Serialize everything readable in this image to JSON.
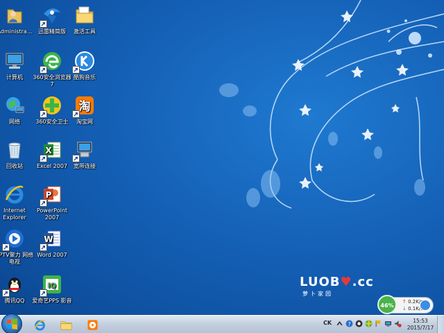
{
  "desktop_icons": [
    {
      "name": "administrator-icon",
      "label": "Administra...",
      "shortcut": false
    },
    {
      "name": "xunlei-icon",
      "label": "迅雷精简版",
      "shortcut": true
    },
    {
      "name": "activation-tools-icon",
      "label": "激活工具",
      "shortcut": false
    },
    {
      "name": "computer-icon",
      "label": "计算机",
      "shortcut": false
    },
    {
      "name": "360-browser-icon",
      "label": "360安全浏览器7",
      "shortcut": true
    },
    {
      "name": "kugou-music-icon",
      "label": "酷狗音乐",
      "shortcut": true
    },
    {
      "name": "network-icon",
      "label": "网络",
      "shortcut": false
    },
    {
      "name": "360-security-icon",
      "label": "360安全卫士",
      "shortcut": true
    },
    {
      "name": "taobao-icon",
      "label": "淘宝网",
      "shortcut": true
    },
    {
      "name": "recycle-bin-icon",
      "label": "回收站",
      "shortcut": false
    },
    {
      "name": "excel-icon",
      "label": "Excel 2007",
      "shortcut": true
    },
    {
      "name": "broadband-icon",
      "label": "宽带连接",
      "shortcut": true
    },
    {
      "name": "internet-explorer-icon",
      "label": "Internet Explorer",
      "shortcut": false
    },
    {
      "name": "powerpoint-icon",
      "label": "PowerPoint 2007",
      "shortcut": true
    },
    {
      "name": "pptv-icon",
      "label": "PPTV聚力 网络电视",
      "shortcut": true
    },
    {
      "name": "word-icon",
      "label": "Word 2007",
      "shortcut": true
    },
    {
      "name": "qq-icon",
      "label": "腾讯QQ",
      "shortcut": true
    },
    {
      "name": "iqiyi-icon",
      "label": "爱奇艺PPS 影音",
      "shortcut": true
    }
  ],
  "logo": {
    "main": "LUOB",
    "suffix": ".cc",
    "sub": "萝卜家园"
  },
  "net_widget": {
    "percent": "46%",
    "upload": "0.2K/s",
    "download": "0.1K/s",
    "up_arrow": "↑",
    "down_arrow": "↓"
  },
  "taskbar": {
    "pinned": [
      {
        "name": "ie-taskbar-icon"
      },
      {
        "name": "explorer-taskbar-icon"
      },
      {
        "name": "media-player-taskbar-icon"
      }
    ],
    "tray_lang": "CK",
    "clock_time": "15:53",
    "clock_date": "2015/7/17"
  },
  "colors": {
    "background": "#1460b6",
    "taskbar": "#c2cfde",
    "accent": "#49b24a"
  }
}
